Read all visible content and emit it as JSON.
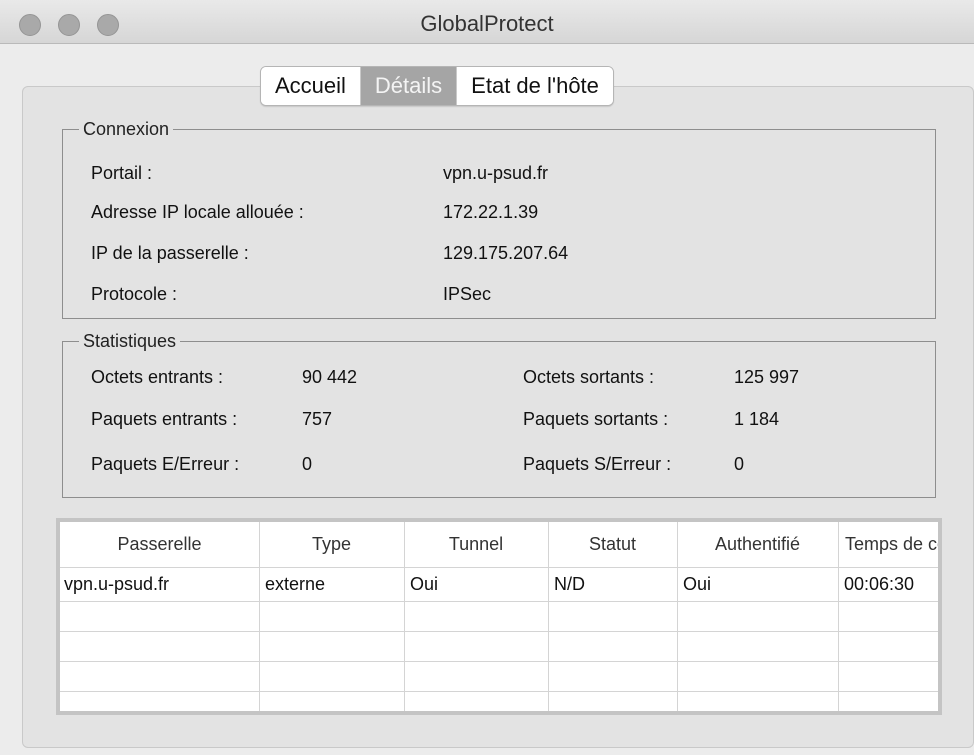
{
  "window": {
    "title": "GlobalProtect"
  },
  "tabs": [
    {
      "label": "Accueil",
      "active": false
    },
    {
      "label": "Détails",
      "active": true
    },
    {
      "label": "Etat de l'hôte",
      "active": false
    }
  ],
  "connexion": {
    "legend": "Connexion",
    "portail_label": "Portail :",
    "portail_value": "vpn.u-psud.fr",
    "ip_locale_label": "Adresse IP locale allouée :",
    "ip_locale_value": "172.22.1.39",
    "ip_passerelle_label": "IP de la passerelle :",
    "ip_passerelle_value": "129.175.207.64",
    "protocole_label": "Protocole :",
    "protocole_value": "IPSec"
  },
  "statistiques": {
    "legend": "Statistiques",
    "octets_entrants_label": "Octets entrants :",
    "octets_entrants_value": "90 442",
    "octets_sortants_label": "Octets sortants :",
    "octets_sortants_value": "125 997",
    "paquets_entrants_label": "Paquets entrants :",
    "paquets_entrants_value": "757",
    "paquets_sortants_label": "Paquets sortants :",
    "paquets_sortants_value": "1 184",
    "paquets_e_erreur_label": "Paquets E/Erreur :",
    "paquets_e_erreur_value": "0",
    "paquets_s_erreur_label": "Paquets S/Erreur :",
    "paquets_s_erreur_value": "0"
  },
  "gateway_table": {
    "headers": [
      "Passerelle",
      "Type",
      "Tunnel",
      "Statut",
      "Authentifié",
      "Temps de connexion"
    ],
    "rows": [
      [
        "vpn.u-psud.fr",
        "externe",
        "Oui",
        "N/D",
        "Oui",
        "00:06:30"
      ]
    ]
  },
  "colors": {
    "active_tab_bg": "#a5a5a5",
    "panel_bg": "#e3e3e3",
    "window_bg": "#ececec"
  }
}
